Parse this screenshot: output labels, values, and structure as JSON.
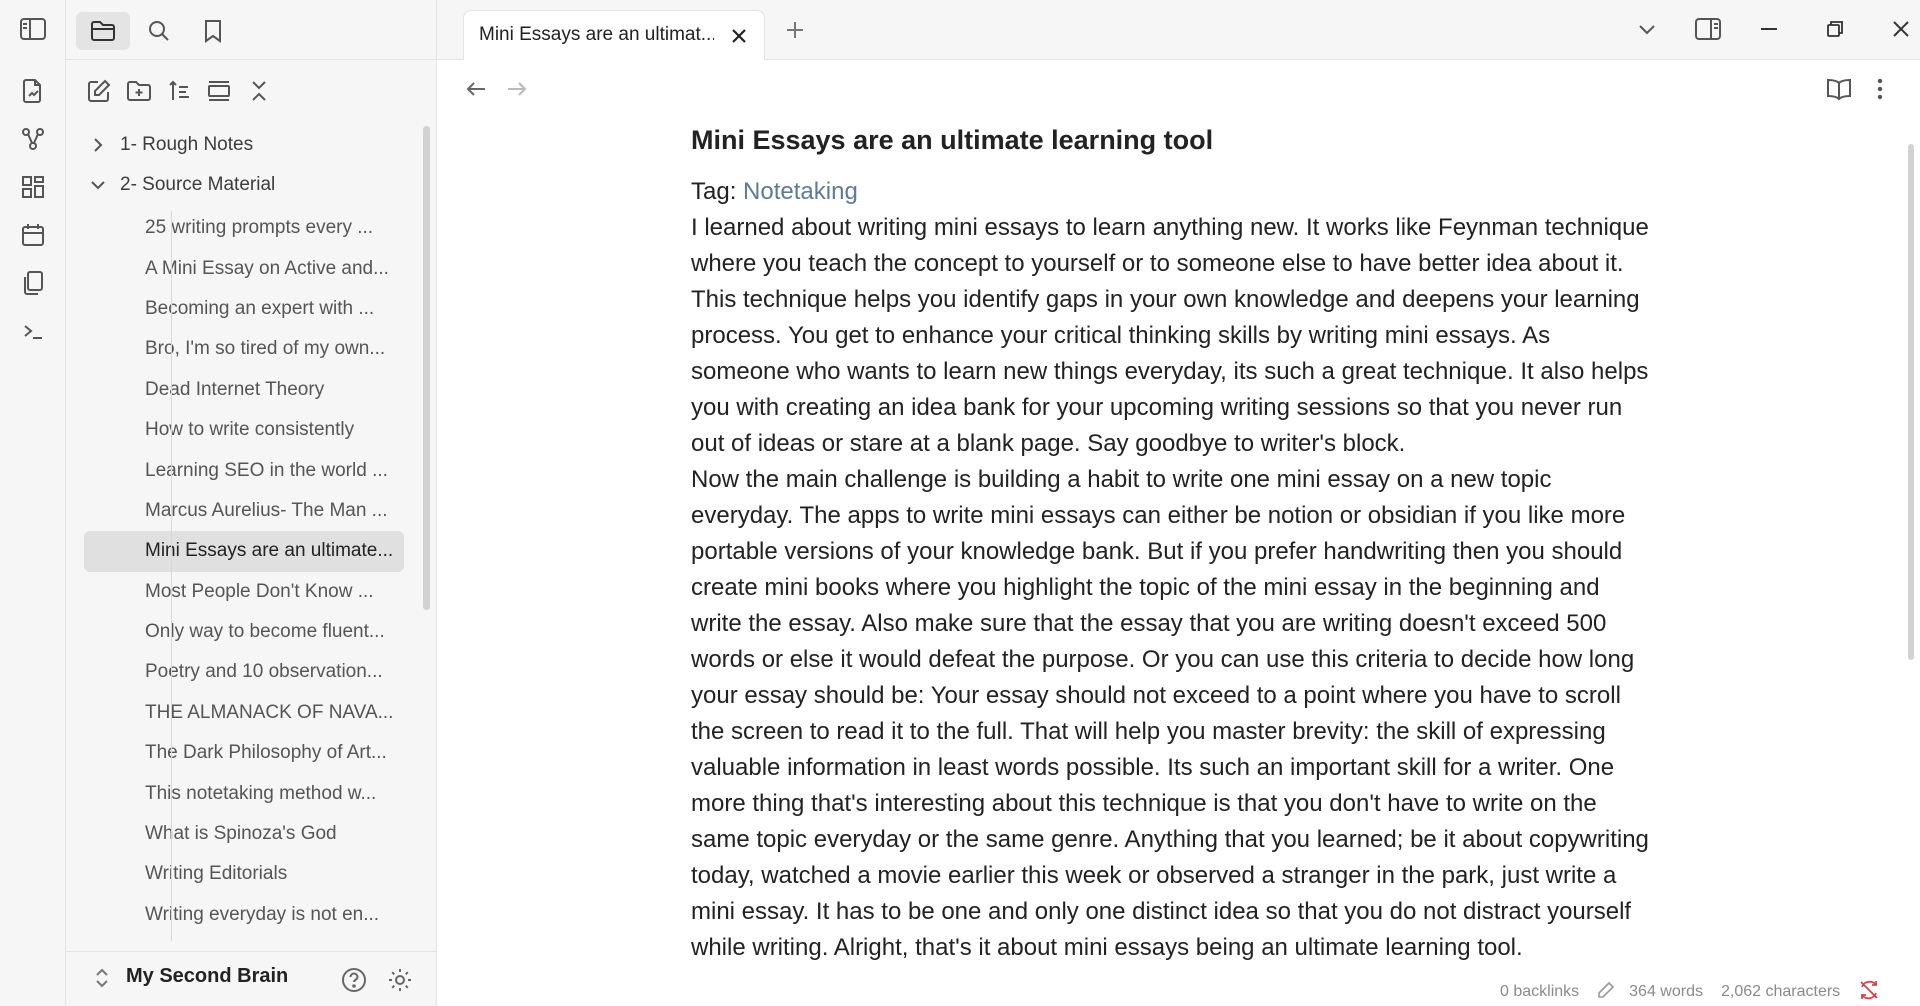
{
  "tab": {
    "title": "Mini Essays are an ultimat..."
  },
  "sidebar": {
    "folders": [
      {
        "label": "1- Rough Notes",
        "expanded": false
      },
      {
        "label": "2- Source Material",
        "expanded": true
      }
    ],
    "files": [
      "25 writing prompts every ...",
      "A Mini Essay on Active and...",
      "Becoming an expert with ...",
      "Bro, I'm so tired of my own...",
      "Dead Internet Theory",
      "How to write consistently",
      "Learning SEO in the world ...",
      "Marcus Aurelius- The Man ...",
      "Mini Essays are an ultimate...",
      "Most People Don't Know ...",
      "Only way to become fluent...",
      "Poetry and 10 observation...",
      "THE ALMANACK OF NAVA...",
      "The Dark Philosophy of Art...",
      "This notetaking method w...",
      "What is Spinoza's God",
      "Writing Editorials",
      "Writing everyday is not en..."
    ],
    "active_file_index": 8,
    "vault_name": "My Second Brain"
  },
  "note": {
    "title": "Mini Essays are an ultimate learning tool",
    "tag_label": "Tag:",
    "tag": "Notetaking",
    "paragraph1": "I learned about writing mini essays to learn anything new. It works like Feynman technique where you teach the concept to yourself or to someone else to have better idea about it. This technique helps you identify gaps in your own knowledge and deepens your learning process. You get to enhance your critical thinking skills by writing mini essays. As someone who wants to learn new things everyday, its such a great technique. It also helps you with creating an idea bank for your upcoming writing sessions so that you never run out of ideas or stare at a blank page. Say goodbye to writer's block.",
    "paragraph2": "Now the main challenge is building a habit to write one mini essay on a new topic everyday. The apps to write mini essays can either be notion or obsidian if you like more portable versions of your knowledge bank. But if you prefer handwriting then you should create mini books where you highlight the topic of the mini essay in the beginning and write the essay. Also make sure that the essay that you are writing doesn't exceed 500 words or else it would defeat the purpose. Or you can use this criteria to decide how long your essay should be: Your essay should not exceed to a point where you have to scroll the screen to read it to the full. That will help you master brevity: the skill of expressing valuable information in least words possible. Its such an important skill for a writer. One more thing that's interesting about this technique is that you don't have to write on the same topic everyday or the same genre. Anything that you learned; be it about copywriting today, watched a movie earlier this week or observed a stranger in the park, just write a mini essay. It has to be one and only one distinct idea so that you do not distract yourself while writing. Alright, that's it about mini essays being an ultimate learning tool."
  },
  "status": {
    "backlinks": "0 backlinks",
    "words": "364 words",
    "characters": "2,062 characters"
  },
  "colors": {
    "tag_link": "#5f7b93",
    "sync_error": "#d0464a",
    "sidebar_bg": "#f6f6f6"
  }
}
